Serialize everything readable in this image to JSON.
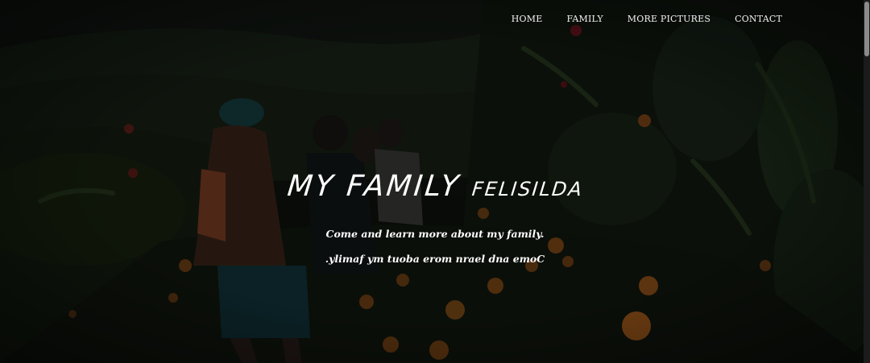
{
  "nav": {
    "items": [
      {
        "label": "HOME"
      },
      {
        "label": "FAMILY"
      },
      {
        "label": "MORE PICTURES"
      },
      {
        "label": "CONTACT"
      }
    ]
  },
  "hero": {
    "title_main": "MY FAMILY",
    "title_sub": "FELISILDA",
    "tagline": "Come and learn more about my family.",
    "tagline_reversed": ".ylimaf ym tuoba erom nrael dna emoC"
  },
  "colors": {
    "overlay": "#000000",
    "text": "#ffffff",
    "flower_orange": "#d9831f",
    "flower_red": "#b8202e"
  }
}
